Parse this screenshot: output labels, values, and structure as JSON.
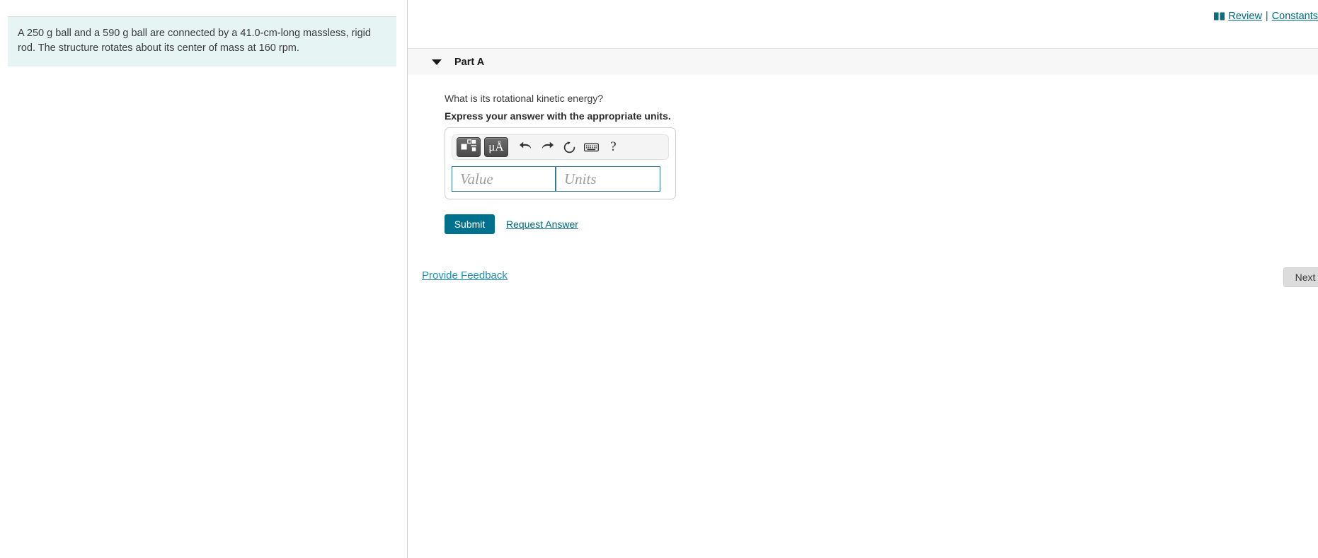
{
  "left_panel": {
    "problem_statement": "A 250 g ball and a 590 g ball are connected by a 41.0-cm-long massless, rigid rod. The structure rotates about its center of mass at 160 rpm."
  },
  "topbar": {
    "book_icon": "book-icon",
    "review_label": "Review",
    "separator": "|",
    "constants_label": "Constants"
  },
  "part": {
    "toggle_icon": "caret-down-icon",
    "title": "Part A",
    "question": "What is its rotational kinetic energy?",
    "instruction": "Express your answer with the appropriate units."
  },
  "math_toolbar": {
    "template_button": "math-template-icon",
    "units_button": "μÅ",
    "undo": "undo-icon",
    "redo": "redo-icon",
    "reset": "reset-icon",
    "keyboard": "keyboard-icon",
    "help": "?"
  },
  "answer": {
    "value_placeholder": "Value",
    "value": "",
    "units_placeholder": "Units",
    "units": ""
  },
  "actions": {
    "submit_label": "Submit",
    "request_answer_label": "Request Answer",
    "provide_feedback_label": "Provide Feedback",
    "next_label": "Next"
  },
  "colors": {
    "problem_box_bg": "#e6f4f3",
    "submit_bg": "#00718d",
    "link": "#00697e",
    "feedback_link": "#1d8fb5",
    "field_border": "#2e7e93",
    "part_header_bg": "#f7f7f7"
  }
}
